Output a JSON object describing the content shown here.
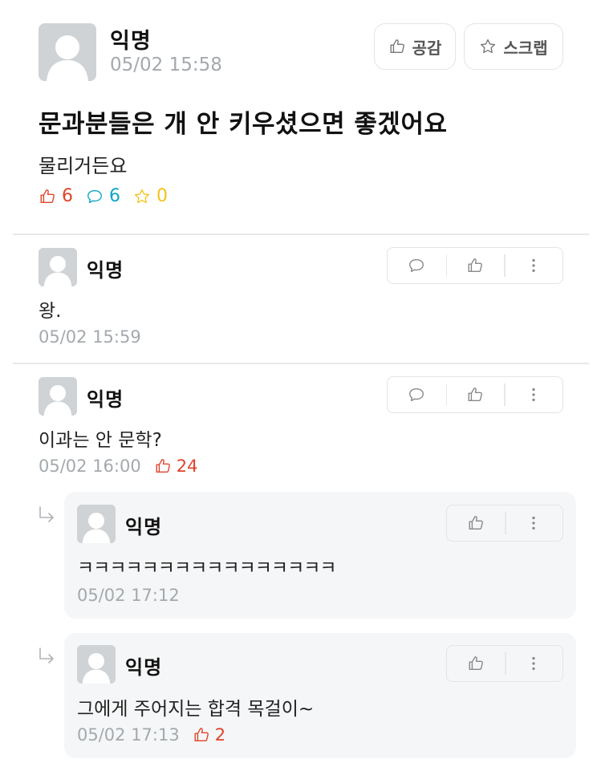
{
  "post": {
    "author": "익명",
    "time": "05/02 15:58",
    "like_button": "공감",
    "scrap_button": "스크랩",
    "title": "문과분들은 개 안 키우셨으면 좋겠어요",
    "body": "물리거든요",
    "stats": {
      "likes": "6",
      "comments": "6",
      "scraps": "0"
    }
  },
  "comments": [
    {
      "author": "익명",
      "text": "왕.",
      "time": "05/02 15:59"
    },
    {
      "author": "익명",
      "text": "이과는 안 문학?",
      "time": "05/02 16:00",
      "likes": "24"
    }
  ],
  "replies": [
    {
      "author": "익명",
      "text": "ㅋㅋㅋㅋㅋㅋㅋㅋㅋㅋㅋㅋㅋㅋㅋㅋ",
      "time": "05/02 17:12"
    },
    {
      "author": "익명",
      "text": "그에게 주어지는 합격 목걸이~",
      "time": "05/02 17:13",
      "likes": "2"
    }
  ],
  "colors": {
    "accent_like": "#e0432b",
    "accent_comment": "#0fa5c2",
    "accent_scrap": "#f3c31c"
  }
}
